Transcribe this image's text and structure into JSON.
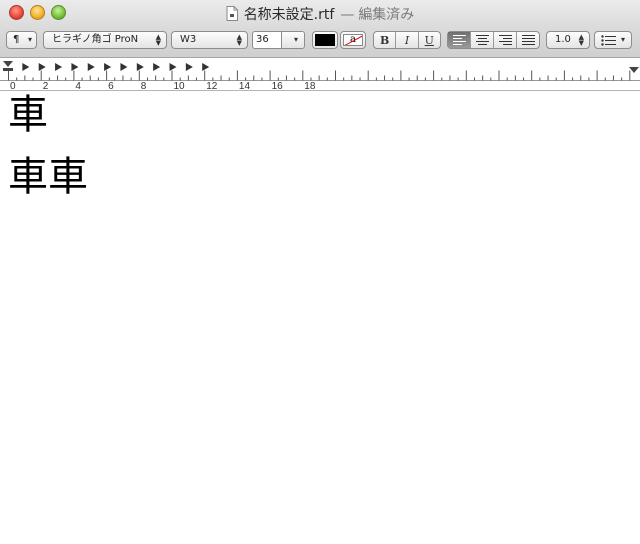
{
  "window": {
    "title": "名称未設定.rtf",
    "title_separator": "—",
    "status": "編集済み"
  },
  "toolbar": {
    "paragraph_menu_label": "¶",
    "font_family": "ヒラギノ角ゴ ProN",
    "font_style": "W3",
    "font_size": "36",
    "text_color": "#000000",
    "background_color_label": "a",
    "bold_label": "B",
    "italic_label": "I",
    "underline_label": "U",
    "alignment_selected": "left",
    "line_spacing": "1.0",
    "list_icon": "list-bullets-icon"
  },
  "ruler": {
    "labels": [
      "0",
      "2",
      "4",
      "6",
      "8",
      "10",
      "12",
      "14",
      "16",
      "18"
    ]
  },
  "document": {
    "lines": [
      "車",
      "車車"
    ]
  }
}
